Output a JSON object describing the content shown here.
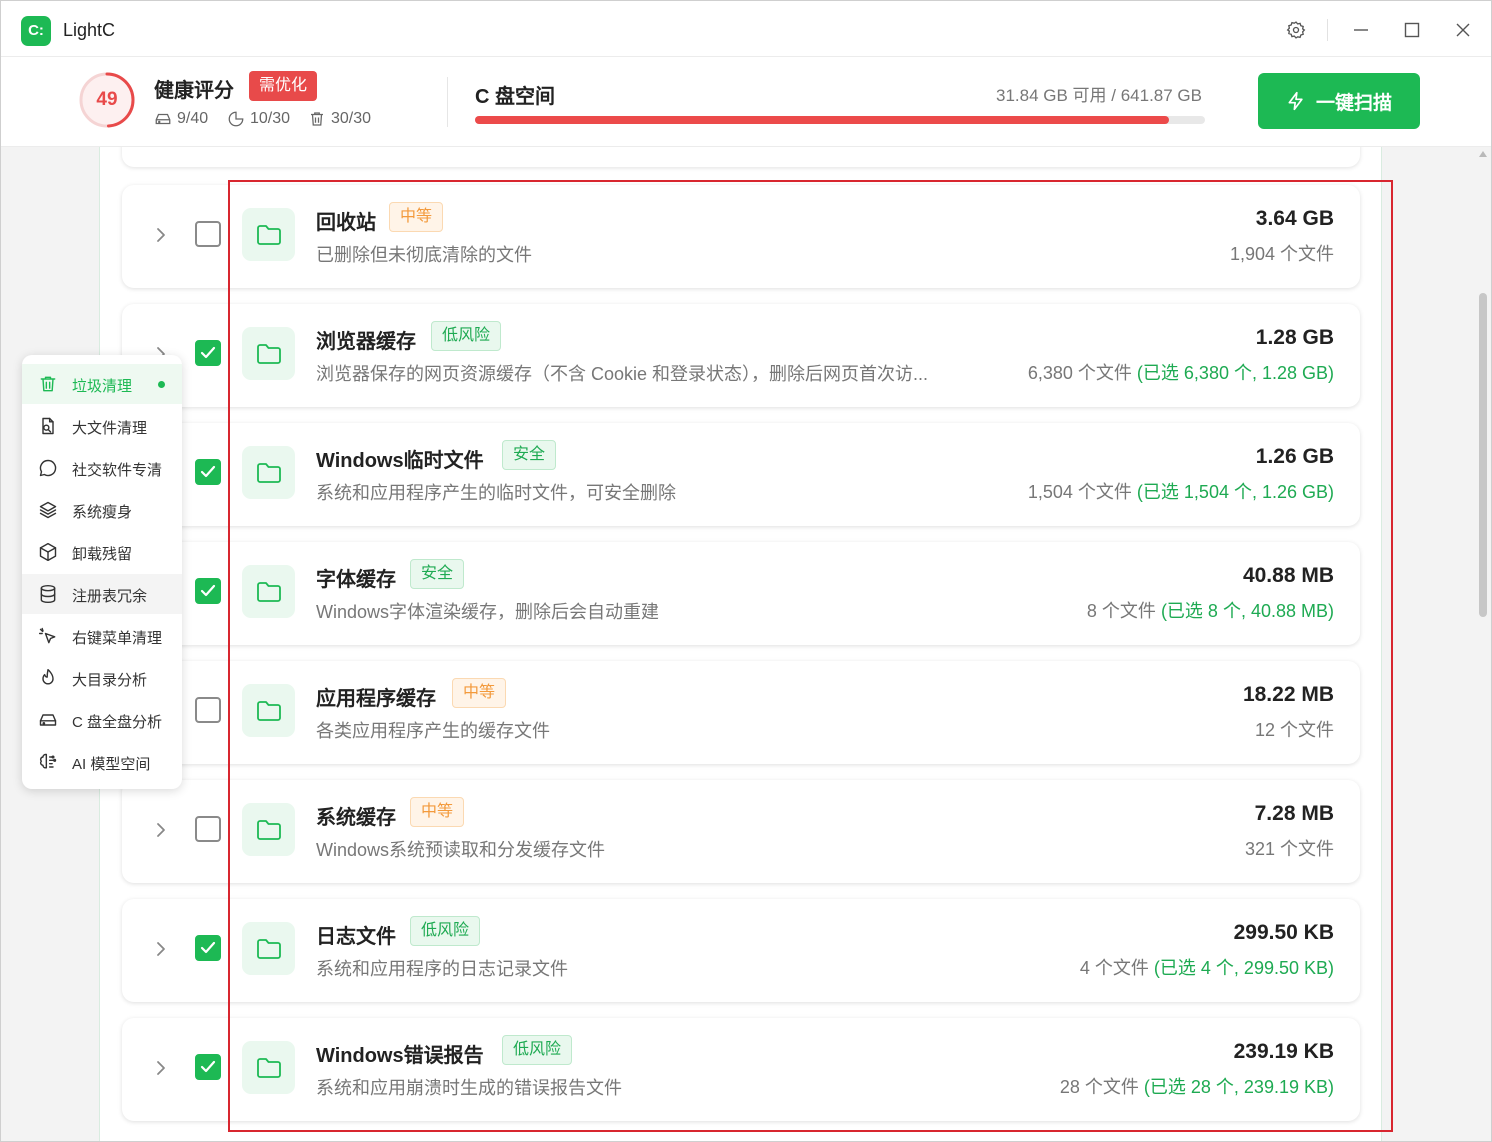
{
  "app": {
    "logo_text": "C:",
    "title": "LightC"
  },
  "titlebar_icons": [
    "gear-icon",
    "minimize-icon",
    "maximize-icon",
    "close-icon"
  ],
  "health": {
    "score": "49",
    "title": "健康评分",
    "badge": "需优化",
    "stats": [
      {
        "icon": "drive-icon",
        "value": "9/40"
      },
      {
        "icon": "clock-icon",
        "value": "10/30"
      },
      {
        "icon": "trash-icon",
        "value": "30/30"
      }
    ],
    "score_fraction": 0.49
  },
  "disk": {
    "title": "C 盘空间",
    "info": "31.84 GB 可用 / 641.87 GB",
    "used_fraction": 0.95
  },
  "scan_button": {
    "label": "一键扫描",
    "icon": "lightning-icon"
  },
  "colors": {
    "accent": "#1db954",
    "danger": "#e84a4a",
    "warning": "#f39a3c",
    "highlight_box": "#d8262f"
  },
  "items": [
    {
      "title": "回收站",
      "tag": "中等",
      "tag_type": "mid",
      "desc": "已删除但未彻底清除的文件",
      "size": "3.64 GB",
      "count": "1,904 个文件",
      "selected": "",
      "checked": false
    },
    {
      "title": "浏览器缓存",
      "tag": "低风险",
      "tag_type": "low",
      "desc": "浏览器保存的网页资源缓存（不含 Cookie 和登录状态），删除后网页首次访...",
      "size": "1.28 GB",
      "count": "6,380 个文件 ",
      "selected": "(已选 6,380 个, 1.28 GB)",
      "checked": true
    },
    {
      "title": "Windows临时文件",
      "tag": "安全",
      "tag_type": "safe",
      "desc": "系统和应用程序产生的临时文件，可安全删除",
      "size": "1.26 GB",
      "count": "1,504 个文件 ",
      "selected": "(已选 1,504 个, 1.26 GB)",
      "checked": true
    },
    {
      "title": "字体缓存",
      "tag": "安全",
      "tag_type": "safe",
      "desc": "Windows字体渲染缓存，删除后会自动重建",
      "size": "40.88 MB",
      "count": "8 个文件 ",
      "selected": "(已选 8 个, 40.88 MB)",
      "checked": true
    },
    {
      "title": "应用程序缓存",
      "tag": "中等",
      "tag_type": "mid",
      "desc": "各类应用程序产生的缓存文件",
      "size": "18.22 MB",
      "count": "12 个文件",
      "selected": "",
      "checked": false
    },
    {
      "title": "系统缓存",
      "tag": "中等",
      "tag_type": "mid",
      "desc": "Windows系统预读取和分发缓存文件",
      "size": "7.28 MB",
      "count": "321 个文件",
      "selected": "",
      "checked": false
    },
    {
      "title": "日志文件",
      "tag": "低风险",
      "tag_type": "low",
      "desc": "系统和应用程序的日志记录文件",
      "size": "299.50 KB",
      "count": "4 个文件 ",
      "selected": "(已选 4 个, 299.50 KB)",
      "checked": true
    },
    {
      "title": "Windows错误报告",
      "tag": "低风险",
      "tag_type": "low",
      "desc": "系统和应用崩溃时生成的错误报告文件",
      "size": "239.19 KB",
      "count": "28 个文件 ",
      "selected": "(已选 28 个, 239.19 KB)",
      "checked": true
    }
  ],
  "menu": [
    {
      "label": "垃圾清理",
      "icon": "trash-icon",
      "active": true
    },
    {
      "label": "大文件清理",
      "icon": "file-search-icon"
    },
    {
      "label": "社交软件专清",
      "icon": "chat-bubble-icon"
    },
    {
      "label": "系统瘦身",
      "icon": "layers-icon"
    },
    {
      "label": "卸载残留",
      "icon": "package-icon"
    },
    {
      "label": "注册表冗余",
      "icon": "database-icon",
      "hover": true
    },
    {
      "label": "右键菜单清理",
      "icon": "cursor-click-icon"
    },
    {
      "label": "大目录分析",
      "icon": "flame-icon"
    },
    {
      "label": "C 盘全盘分析",
      "icon": "hard-drive-icon"
    },
    {
      "label": "AI 模型空间",
      "icon": "brain-icon"
    }
  ]
}
